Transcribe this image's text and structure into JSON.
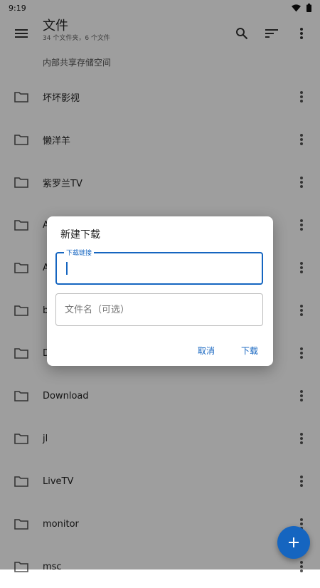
{
  "status": {
    "time": "9:19"
  },
  "app_bar": {
    "title": "文件",
    "subtitle": "34 个文件夹，6 个文件",
    "icons": [
      "menu-icon",
      "search-icon",
      "sort-icon",
      "more-vert-icon"
    ]
  },
  "breadcrumb": "内部共享存储空间",
  "list": {
    "items": [
      {
        "name": "坏坏影视"
      },
      {
        "name": "懒洋羊"
      },
      {
        "name": "紫罗兰TV"
      },
      {
        "name": "A"
      },
      {
        "name": "A"
      },
      {
        "name": "b"
      },
      {
        "name": "D"
      },
      {
        "name": "Download"
      },
      {
        "name": "jl"
      },
      {
        "name": "LiveTV"
      },
      {
        "name": "monitor"
      },
      {
        "name": "msc"
      }
    ]
  },
  "dialog": {
    "title": "新建下载",
    "url_label": "下载链接",
    "url_value": "",
    "filename_placeholder": "文件名（可选）",
    "cancel_label": "取消",
    "download_label": "下载"
  },
  "colors": {
    "accent": "#1565c0",
    "scrim": "rgba(0,0,0,0.38)"
  }
}
